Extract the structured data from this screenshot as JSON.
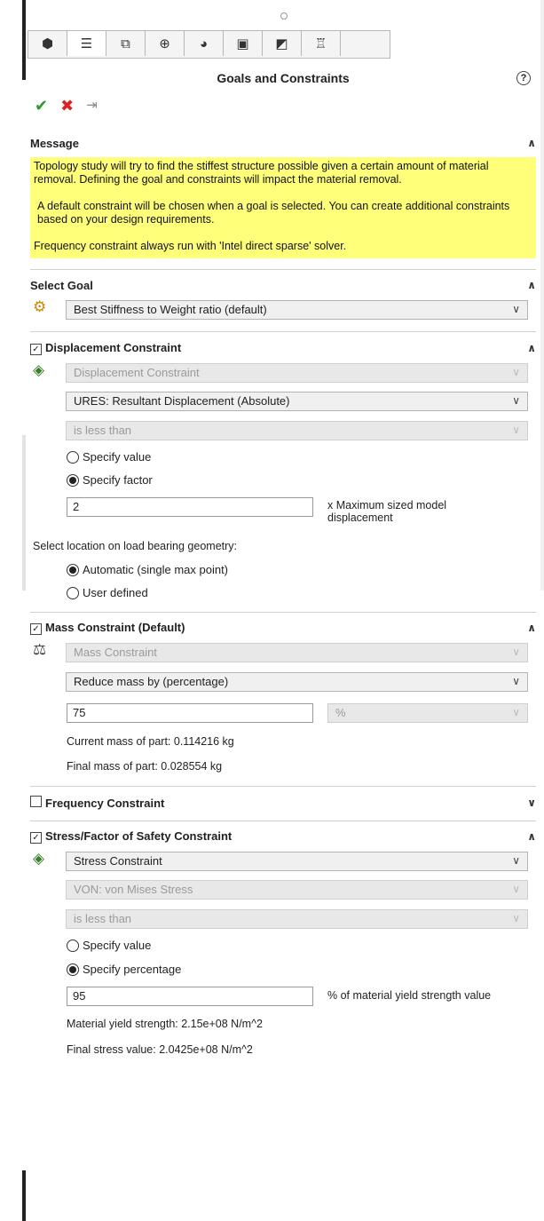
{
  "header": {
    "title": "Goals and Constraints"
  },
  "tabs": [
    "tab1",
    "tab2",
    "tab3",
    "tab4",
    "tab5",
    "tab6",
    "tab7",
    "tab8",
    "tab9"
  ],
  "message": {
    "label": "Message",
    "p1": "Topology study will try to find the stiffest structure possible given a certain amount of material removal. Defining the goal and constraints will impact the material removal.",
    "p2": "A default constraint will be chosen when a goal is selected. You can create additional constraints based on your design requirements.",
    "p3": "Frequency constraint always run with 'Intel direct sparse' solver."
  },
  "goal": {
    "label": "Select Goal",
    "value": "Best Stiffness to Weight ratio (default)"
  },
  "displacement": {
    "label": "Displacement Constraint",
    "type": "Displacement Constraint",
    "component": "URES:  Resultant Displacement (Absolute)",
    "condition": "is less than",
    "opt_value": "Specify value",
    "opt_factor": "Specify factor",
    "factor": "2",
    "factor_note": "x Maximum sized model displacement",
    "location_label": "Select location on load bearing geometry:",
    "loc_auto": "Automatic (single max point)",
    "loc_user": "User defined"
  },
  "mass": {
    "label": "Mass Constraint (Default)",
    "type": "Mass Constraint",
    "mode": "Reduce mass by (percentage)",
    "value": "75",
    "unit": "%",
    "current": "Current mass of part: 0.114216 kg",
    "final": "Final mass of part: 0.028554 kg"
  },
  "frequency": {
    "label": "Frequency Constraint"
  },
  "stress": {
    "label": "Stress/Factor of Safety Constraint",
    "type": "Stress Constraint",
    "component": "VON: von Mises Stress",
    "condition": "is less than",
    "opt_value": "Specify value",
    "opt_percent": "Specify percentage",
    "value": "95",
    "value_note": "% of material yield strength value",
    "yield": "Material yield strength: 2.15e+08 N/m^2",
    "final": "Final stress value: 2.0425e+08 N/m^2"
  },
  "colors": {
    "message_bg": "#ffff7a",
    "ok": "#2a9a2a",
    "cancel": "#d22222"
  }
}
